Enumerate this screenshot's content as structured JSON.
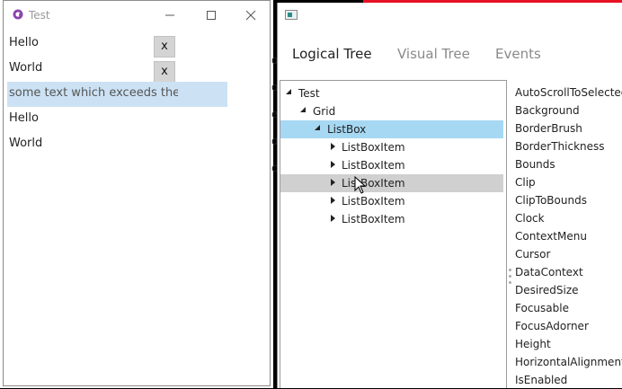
{
  "window1": {
    "title": "Test",
    "items": [
      {
        "text": "Hello",
        "button": "x"
      },
      {
        "text": "World",
        "button": "x"
      },
      {
        "text": "some text which exceeds the width of the listbox",
        "selected": true
      },
      {
        "text": "Hello"
      },
      {
        "text": "World"
      }
    ]
  },
  "window2": {
    "tabs": [
      "Logical Tree",
      "Visual Tree",
      "Events"
    ],
    "tree": [
      {
        "label": "Test",
        "state": "expanded",
        "level": 0
      },
      {
        "label": "Grid",
        "state": "expanded",
        "level": 1
      },
      {
        "label": "ListBox",
        "state": "expanded",
        "level": 2,
        "highlight": "selected"
      },
      {
        "label": "ListBoxItem",
        "state": "collapsed",
        "level": 3
      },
      {
        "label": "ListBoxItem",
        "state": "collapsed",
        "level": 3
      },
      {
        "label": "ListBoxItem",
        "state": "collapsed",
        "level": 3,
        "highlight": "hover"
      },
      {
        "label": "ListBoxItem",
        "state": "collapsed",
        "level": 3
      },
      {
        "label": "ListBoxItem",
        "state": "collapsed",
        "level": 3
      }
    ],
    "properties": [
      "AutoScrollToSelectedItem",
      "Background",
      "BorderBrush",
      "BorderThickness",
      "Bounds",
      "Clip",
      "ClipToBounds",
      "Clock",
      "ContextMenu",
      "Cursor",
      "DataContext",
      "DesiredSize",
      "Focusable",
      "FocusAdorner",
      "Height",
      "HorizontalAlignment",
      "IsEnabled"
    ]
  },
  "background": {
    "edge_letters": [
      "o",
      "o",
      "e",
      "o",
      "c"
    ]
  },
  "colors": {
    "selected_item": "#cce2f4",
    "tree_selected": "#a6d8f4",
    "tree_hover": "#d0d0d0",
    "accent_red": "#e81123"
  }
}
